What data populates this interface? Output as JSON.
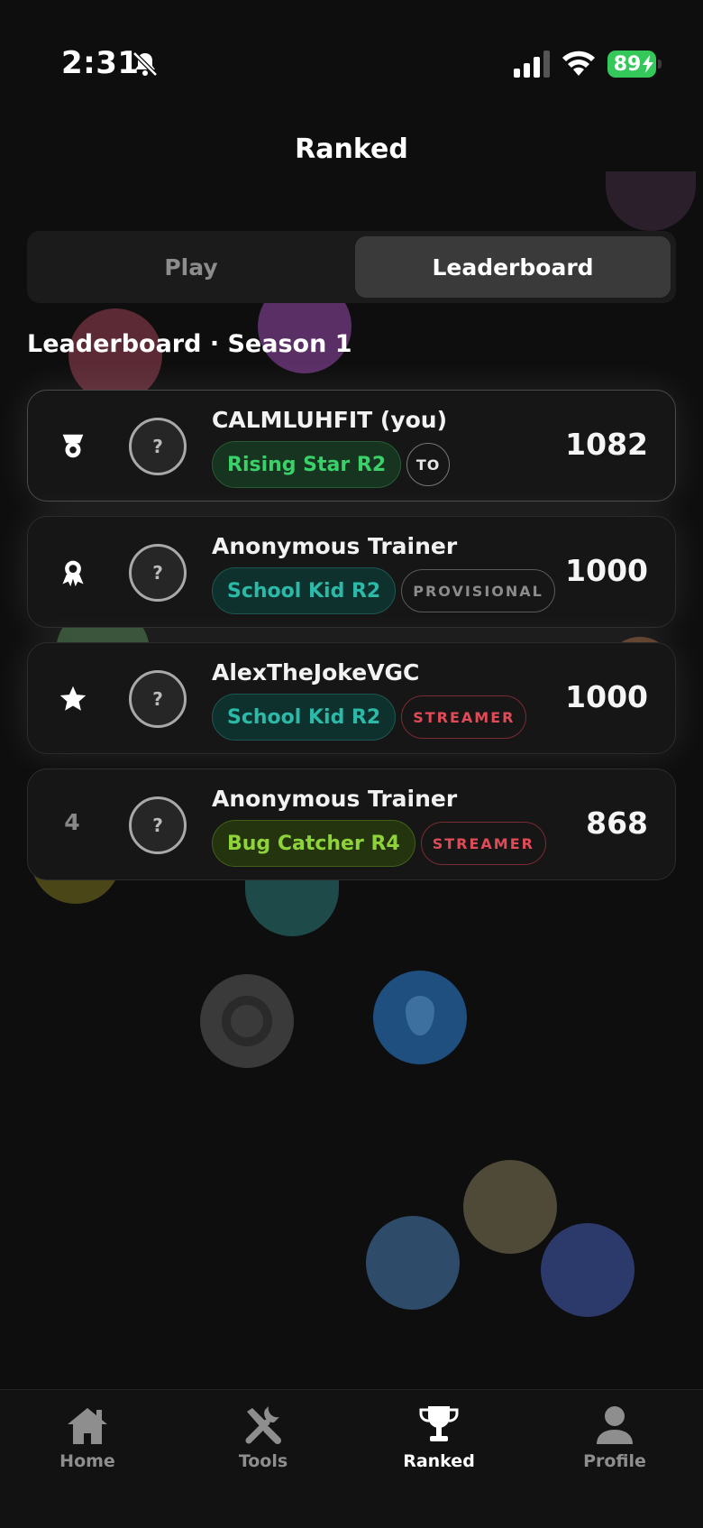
{
  "status_bar": {
    "time": "2:31",
    "battery": "89"
  },
  "header": {
    "title": "Ranked"
  },
  "segmented_control": {
    "play_label": "Play",
    "leaderboard_label": "Leaderboard",
    "selected": "Leaderboard"
  },
  "leaderboard": {
    "section_title": "Leaderboard · Season 1",
    "rows": [
      {
        "rank_icon": "medal-icon",
        "avatar": "?",
        "name": "CALMLUHFIT  (you)",
        "rank_badge": "Rising Star R2",
        "tag": "TO",
        "score": "1082"
      },
      {
        "rank_icon": "ribbon-icon",
        "avatar": "?",
        "name": "Anonymous Trainer",
        "rank_badge": "School Kid R2",
        "tag": "PROVISIONAL",
        "score": "1000"
      },
      {
        "rank_icon": "star-icon",
        "avatar": "?",
        "name": "AlexTheJokeVGC",
        "rank_badge": "School Kid R2",
        "tag": "STREAMER",
        "score": "1000"
      },
      {
        "rank": "4",
        "avatar": "?",
        "name": "Anonymous Trainer",
        "rank_badge": "Bug Catcher R4",
        "tag": "STREAMER",
        "score": "868"
      }
    ]
  },
  "tab_bar": {
    "items": [
      {
        "label": "Home",
        "icon": "house-icon"
      },
      {
        "label": "Tools",
        "icon": "tools-icon"
      },
      {
        "label": "Ranked",
        "icon": "trophy-icon",
        "active": true
      },
      {
        "label": "Profile",
        "icon": "person-icon"
      }
    ]
  },
  "colors": {
    "background": "#0e0e0e",
    "card": "#161616",
    "battery_green": "#34c759",
    "rising_star_green": "#3ad16a",
    "school_kid_teal": "#2bb9a8",
    "bug_catcher_lime": "#8fd33a",
    "streamer_red": "#e04b58"
  }
}
